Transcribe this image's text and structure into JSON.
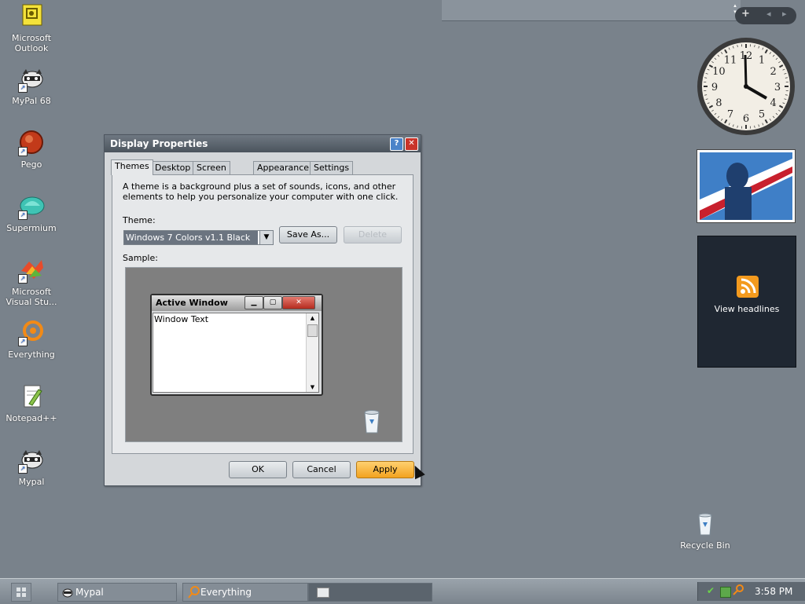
{
  "desktop": {
    "icons": [
      {
        "label": "Microsoft Outlook"
      },
      {
        "label": "MyPal 68"
      },
      {
        "label": "Pego"
      },
      {
        "label": "Supermium"
      },
      {
        "label": "Microsoft Visual Stu..."
      },
      {
        "label": "Everything"
      },
      {
        "label": "Notepad++"
      },
      {
        "label": "Mypal"
      }
    ],
    "recycle_bin": "Recycle Bin"
  },
  "sidebar": {
    "controls": {
      "add": "+",
      "prev": "◂",
      "next": "▸"
    },
    "clock": {
      "numerals": [
        "12",
        "1",
        "2",
        "3",
        "4",
        "5",
        "6",
        "7",
        "8",
        "9",
        "10",
        "11"
      ]
    },
    "feed": {
      "label": "View headlines"
    }
  },
  "dialog": {
    "title": "Display Properties",
    "tabs": [
      "Themes",
      "Desktop",
      "Screen Saver",
      "Appearance",
      "Settings"
    ],
    "description": "A theme is a background plus a set of sounds, icons, and other elements to help you personalize your computer with one click.",
    "theme_label": "Theme:",
    "theme_value": "Windows 7 Colors v1.1 Black",
    "save_as": "Save As...",
    "delete": "Delete",
    "sample_label": "Sample:",
    "sample": {
      "window_title": "Active Window",
      "window_text": "Window Text"
    },
    "ok": "OK",
    "cancel": "Cancel",
    "apply": "Apply"
  },
  "taskbar": {
    "tasks": [
      {
        "label": "Mypal"
      },
      {
        "label": "Everything"
      }
    ],
    "time": "3:58 PM"
  }
}
